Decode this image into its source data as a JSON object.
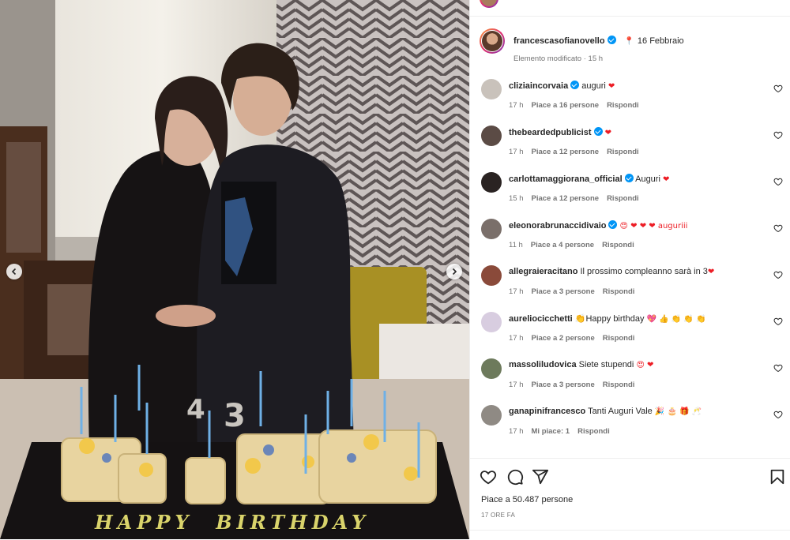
{
  "post": {
    "author": "francescasofianovello",
    "caption_pin": "📍",
    "caption_text": "16 Febbraio",
    "edited": "Elemento modificato",
    "edited_time": "15 h",
    "likes": "Piace a 50.487 persone",
    "time_ago": "17 ORE FA",
    "photo_text": "HAPPY  BIRTHDAY"
  },
  "labels": {
    "reply": "Rispondi"
  },
  "comments": [
    {
      "user": "cliziaincorvaia",
      "verified": true,
      "text": "auguri",
      "emoji": "❤",
      "time": "17 h",
      "likes": "Piace a 16 persone",
      "avatar": "#c9c2bb"
    },
    {
      "user": "thebeardedpublicist",
      "verified": true,
      "text": "",
      "emoji": "❤",
      "time": "17 h",
      "likes": "Piace a 12 persone",
      "avatar": "#5b4b45"
    },
    {
      "user": "carlottamaggiorana_official",
      "verified": true,
      "text": "Auguri",
      "emoji": "❤",
      "time": "15 h",
      "likes": "Piace a 12 persone",
      "avatar": "#2a2322"
    },
    {
      "user": "eleonorabrunaccidivaio",
      "verified": true,
      "text": "",
      "emoji": "😍 ❤ ❤ ❤ auguriii",
      "time": "11 h",
      "likes": "Piace a 4 persone",
      "avatar": "#7a6f6a"
    },
    {
      "user": "allegraieracitano",
      "verified": false,
      "text": "Il prossimo compleanno sarà in 3",
      "emoji": "❤",
      "time": "17 h",
      "likes": "Piace a 3 persone",
      "avatar": "#8a4a3a"
    },
    {
      "user": "aureliocicchetti",
      "verified": false,
      "text": "👏Happy birthday",
      "emoji": "💖 👍 👏 👏 👏",
      "time": "17 h",
      "likes": "Piace a 2 persone",
      "avatar": "#d8cde0"
    },
    {
      "user": "massoliludovica",
      "verified": false,
      "text": "Siete stupendi",
      "emoji": "😍 ❤",
      "time": "17 h",
      "likes": "Piace a 3 persone",
      "avatar": "#6d7a5c"
    },
    {
      "user": "ganapinifrancesco",
      "verified": false,
      "text": "Tanti Auguri Vale",
      "emoji": "🎉 🎂 🎁 🥂",
      "time": "17 h",
      "likes": "Mi piace: 1",
      "avatar": "#8f8a84"
    }
  ],
  "icons": {
    "like": "heart-icon",
    "comment": "comment-icon",
    "share": "share-icon",
    "save": "bookmark-icon",
    "prev": "chevron-left-icon",
    "next": "chevron-right-icon"
  },
  "colors": {
    "verified": "#0095f6",
    "heart": "#ed1c24",
    "meta": "#737373",
    "text": "#262626"
  }
}
